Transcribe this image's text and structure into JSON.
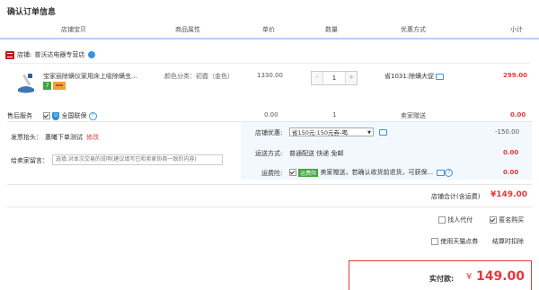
{
  "page_title": "确认订单信息",
  "headers": {
    "store_item": "店铺宝贝",
    "attributes": "商品属性",
    "unit_price": "单价",
    "quantity": "数量",
    "discount": "优惠方式",
    "subtotal": "小计"
  },
  "store": {
    "label": "店铺:",
    "name": "普沃达电器专营店"
  },
  "item": {
    "title": "宝家丽除螨仪家用床上吸除螨虫...",
    "attribute": "颜色分类：初霞（金色）",
    "price": "1330.00",
    "quantity": "1",
    "discount_text": "省1031:除螨大促",
    "subtotal": "299.00",
    "badge_days": "7"
  },
  "after_sale": {
    "label": "售后服务",
    "insurance": "全国联保",
    "price": "0.00",
    "quantity": "1",
    "seller": "卖家赠送",
    "subtotal": "0.00"
  },
  "invoice": {
    "label": "发票抬头：",
    "value": "惠曦下单测试",
    "edit": "修改"
  },
  "message": {
    "label": "给卖家留言：",
    "placeholder": "选填:对本次交易的说明(建议填写已和卖家协商一致的内容)"
  },
  "coupon": {
    "label": "店铺优惠:",
    "selected": "省150元:150元券-喝",
    "amount": "-150.00"
  },
  "shipping": {
    "label": "运送方式:",
    "value": "普通配送 快递 免邮",
    "amount": "0.00"
  },
  "insurance_freight": {
    "label": "运费险:",
    "tag": "运费险",
    "text": "卖家赠送，若确认收货前退货，可获保...",
    "amount": "0.00"
  },
  "store_total": {
    "label": "店铺合计(含运费)",
    "amount": "¥149.00"
  },
  "options": {
    "proxy_pay": "找人代付",
    "anonymous": "匿名购买",
    "tmall_points": "使用天猫点券",
    "points_deduct": "结算时扣除"
  },
  "payment": {
    "label": "实付款:",
    "yen": "¥",
    "amount": "149.00"
  },
  "colors": {
    "accent_red": "#e4393c",
    "header_line": "#b7cff1",
    "panel_bg": "#f3f8fe",
    "link_blue": "#3b93de"
  }
}
